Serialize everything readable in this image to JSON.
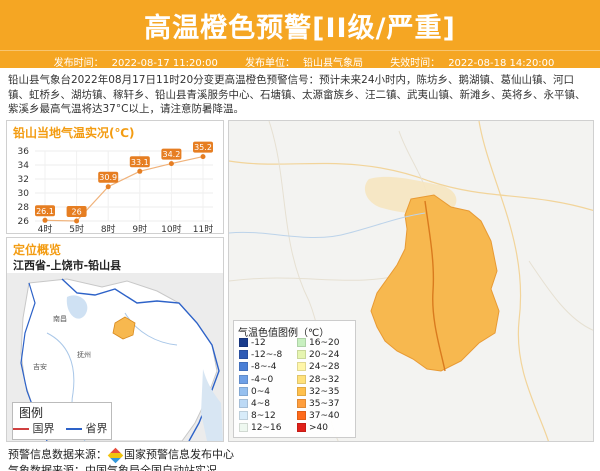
{
  "header": {
    "title": "高温橙色预警[II级/严重]",
    "publish_time_label": "发布时间：",
    "publish_time": "2022-08-17 11:20:00",
    "publish_unit_label": "发布单位：",
    "publish_unit": "铅山县气象局",
    "expire_label": "失效时间：",
    "expire_time": "2022-08-18 14:20:00"
  },
  "description": "铅山县气象台2022年08月17日11时20分变更高温橙色预警信号：预计未来24小时内，陈坊乡、鹅湖镇、葛仙山镇、河口镇、虹桥乡、湖坊镇、稼轩乡、铅山县青溪服务中心、石塘镇、太源畲族乡、汪二镇、武夷山镇、新滩乡、英将乡、永平镇、紫溪乡最高气温将达37°C以上，请注意防暑降温。",
  "temperature": {
    "title": "铅山当地气温实况(℃)"
  },
  "chart_data": {
    "type": "line",
    "title": "铅山当地气温实况(℃)",
    "categories": [
      "4时",
      "5时",
      "8时",
      "9时",
      "10时",
      "11时"
    ],
    "values": [
      26.1,
      26,
      30.9,
      33.1,
      34.2,
      35.2
    ],
    "ylim": [
      26,
      36
    ],
    "yticks": [
      "36",
      "34",
      "32",
      "30",
      "28",
      "26"
    ],
    "grid": true,
    "color": "#e67e22"
  },
  "location": {
    "title": "定位概览",
    "path": "江西省-上饶市-铅山县",
    "map_labels": [
      "南昌",
      "抚州",
      "吉安"
    ],
    "legend_title": "图例",
    "legend_national": "国界",
    "legend_province": "省界"
  },
  "map": {
    "legend_title": "气温色值图例（℃）",
    "scale": [
      {
        "label": "-12",
        "color": "#1a3c8c"
      },
      {
        "label": "-12~-8",
        "color": "#2f5bb5"
      },
      {
        "label": "-8~-4",
        "color": "#4a7fd6"
      },
      {
        "label": "-4~0",
        "color": "#6fa0e6"
      },
      {
        "label": "0~4",
        "color": "#96c0ef"
      },
      {
        "label": "4~8",
        "color": "#bcd9f5"
      },
      {
        "label": "8~12",
        "color": "#d8ecfa"
      },
      {
        "label": "12~16",
        "color": "#eef8f0"
      },
      {
        "label": "16~20",
        "color": "#c8f0c0"
      },
      {
        "label": "20~24",
        "color": "#e6f5b0"
      },
      {
        "label": "24~28",
        "color": "#fff6a8"
      },
      {
        "label": "28~32",
        "color": "#ffe17a"
      },
      {
        "label": "32~35",
        "color": "#ffc04d"
      },
      {
        "label": "35~37",
        "color": "#ff9e3d"
      },
      {
        "label": "37~40",
        "color": "#ff6a1a"
      },
      {
        "label": ">40",
        "color": "#e0201a"
      }
    ]
  },
  "footer": {
    "source": "预警信息数据来源：",
    "source_org": "国家预警信息发布中心",
    "weather_source": "气象数据来源：中国气象局全国自动站实况"
  },
  "colors": {
    "accent": "#f5a623",
    "county_fill": "#f7b84f",
    "label_orange": "#e67e22"
  }
}
